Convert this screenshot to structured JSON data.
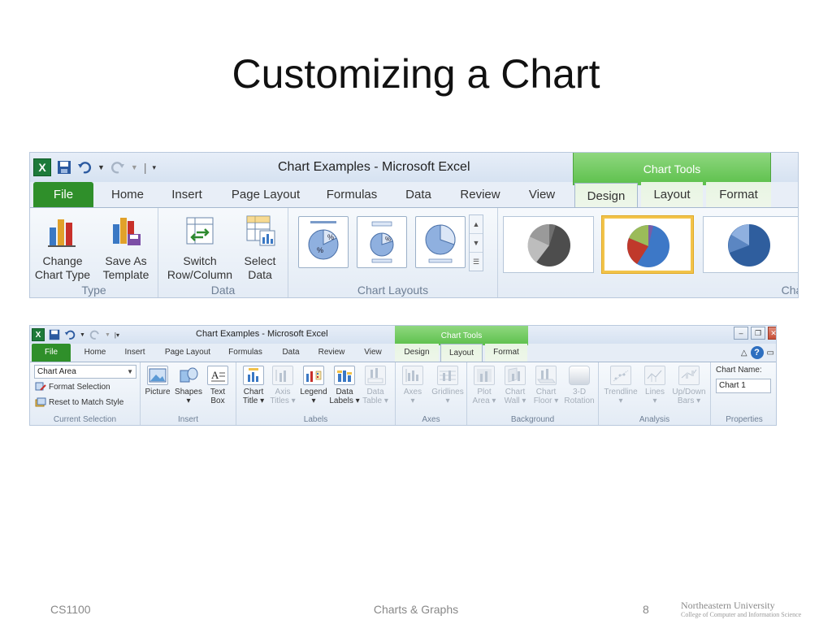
{
  "slide": {
    "title": "Customizing a Chart",
    "footer_left": "CS1100",
    "footer_center": "Charts & Graphs",
    "page_number": "8",
    "logo_line1": "Northeastern University",
    "logo_line2": "College of Computer and Information Science"
  },
  "ribbon_design": {
    "window_title": "Chart Examples  -  Microsoft Excel",
    "contextual_tab_group": "Chart Tools",
    "tabs": [
      "File",
      "Home",
      "Insert",
      "Page Layout",
      "Formulas",
      "Data",
      "Review",
      "View",
      "Design",
      "Layout",
      "Format"
    ],
    "active_tab": "Design",
    "groups": {
      "type": {
        "label": "Type",
        "buttons": [
          {
            "line1": "Change",
            "line2": "Chart Type"
          },
          {
            "line1": "Save As",
            "line2": "Template"
          }
        ]
      },
      "data": {
        "label": "Data",
        "buttons": [
          {
            "line1": "Switch",
            "line2": "Row/Column"
          },
          {
            "line1": "Select",
            "line2": "Data"
          }
        ]
      },
      "layouts": {
        "label": "Chart Layouts"
      },
      "styles": {
        "label": "Char"
      }
    }
  },
  "ribbon_layout": {
    "window_title": "Chart Examples  -  Microsoft Excel",
    "contextual_tab_group": "Chart Tools",
    "tabs": [
      "File",
      "Home",
      "Insert",
      "Page Layout",
      "Formulas",
      "Data",
      "Review",
      "View",
      "Design",
      "Layout",
      "Format"
    ],
    "active_tab": "Layout",
    "current_selection": {
      "label": "Current Selection",
      "dropdown_value": "Chart Area",
      "format_selection": "Format Selection",
      "reset_to_match_style": "Reset to Match Style"
    },
    "insert": {
      "label": "Insert",
      "buttons": [
        {
          "line1": "Picture",
          "line2": ""
        },
        {
          "line1": "Shapes",
          "line2": "▾"
        },
        {
          "line1": "Text",
          "line2": "Box"
        }
      ]
    },
    "labels": {
      "label": "Labels",
      "buttons": [
        {
          "line1": "Chart",
          "line2": "Title ▾"
        },
        {
          "line1": "Axis",
          "line2": "Titles ▾"
        },
        {
          "line1": "Legend",
          "line2": "▾"
        },
        {
          "line1": "Data",
          "line2": "Labels ▾"
        },
        {
          "line1": "Data",
          "line2": "Table ▾"
        }
      ]
    },
    "axes": {
      "label": "Axes",
      "buttons": [
        {
          "line1": "Axes",
          "line2": "▾"
        },
        {
          "line1": "Gridlines",
          "line2": "▾"
        }
      ]
    },
    "background": {
      "label": "Background",
      "buttons": [
        {
          "line1": "Plot",
          "line2": "Area ▾"
        },
        {
          "line1": "Chart",
          "line2": "Wall ▾"
        },
        {
          "line1": "Chart",
          "line2": "Floor ▾"
        },
        {
          "line1": "3-D",
          "line2": "Rotation"
        }
      ]
    },
    "analysis": {
      "label": "Analysis",
      "buttons": [
        {
          "line1": "Trendline",
          "line2": "▾"
        },
        {
          "line1": "Lines",
          "line2": "▾"
        },
        {
          "line1": "Up/Down",
          "line2": "Bars ▾"
        }
      ]
    },
    "properties": {
      "label": "Properties",
      "chart_name_label": "Chart Name:",
      "chart_name_value": "Chart 1"
    }
  },
  "colors": {
    "file_tab": "#2f8f2a",
    "chart_tools": "#6cc65a",
    "selected_style_border": "#f2c34a",
    "ribbon_bg": "#e6edf6"
  }
}
